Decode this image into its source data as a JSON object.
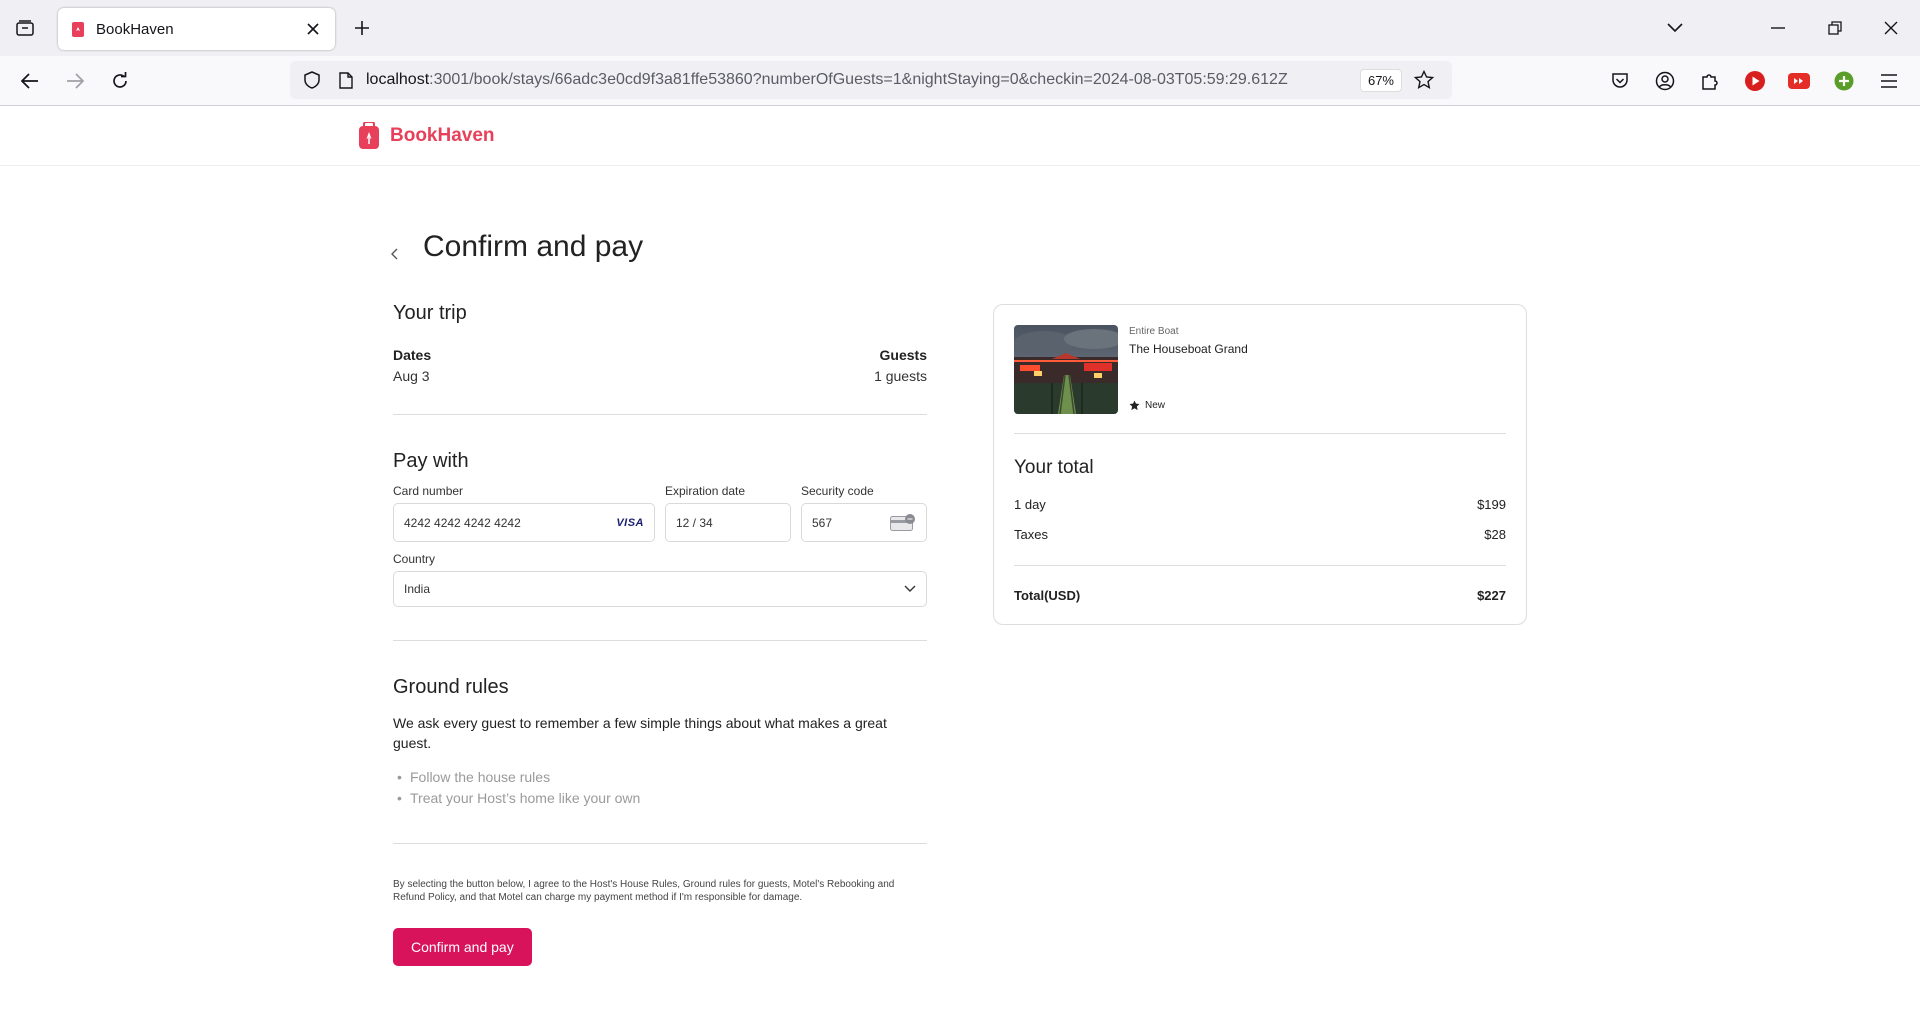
{
  "browser": {
    "tab_title": "BookHaven",
    "url_host": "localhost",
    "url_rest": ":3001/book/stays/66adc3e0cd9f3a81ffe53860?numberOfGuests=1&nightStaying=0&checkin=2024-08-03T05:59:29.612Z",
    "zoom": "67%"
  },
  "site": {
    "brand": "BookHaven",
    "brand_color": "#e8405b"
  },
  "page": {
    "title": "Confirm and pay"
  },
  "trip": {
    "title": "Your trip",
    "dates_label": "Dates",
    "dates_value": "Aug 3",
    "guests_label": "Guests",
    "guests_value": "1 guests"
  },
  "payment": {
    "title": "Pay with",
    "card_label": "Card number",
    "card_value": "4242 4242 4242 4242",
    "card_brand": "VISA",
    "exp_label": "Expiration date",
    "exp_value": "12 / 34",
    "cvc_label": "Security code",
    "cvc_value": "567",
    "country_label": "Country",
    "country_value": "India"
  },
  "rules": {
    "title": "Ground rules",
    "intro": "We ask every guest to remember a few simple things about what makes a great guest.",
    "items": [
      "Follow the house rules",
      "Treat your Host’s home like your own"
    ]
  },
  "agreement": {
    "text": "By selecting the button below, I agree to the Host's House Rules, Ground rules for guests, Motel's Rebooking and Refund Policy, and that Motel can charge my payment method if I'm responsible for damage.",
    "button_label": "Confirm and pay",
    "button_color": "#d8125b"
  },
  "summary": {
    "property_type": "Entire Boat",
    "property_name": "The Houseboat Grand",
    "rating_label": "New",
    "total_title": "Your total",
    "lines": [
      {
        "label": "1 day",
        "amount": "$199"
      },
      {
        "label": "Taxes",
        "amount": "$28"
      }
    ],
    "total_label": "Total(USD)",
    "total_amount": "$227"
  }
}
